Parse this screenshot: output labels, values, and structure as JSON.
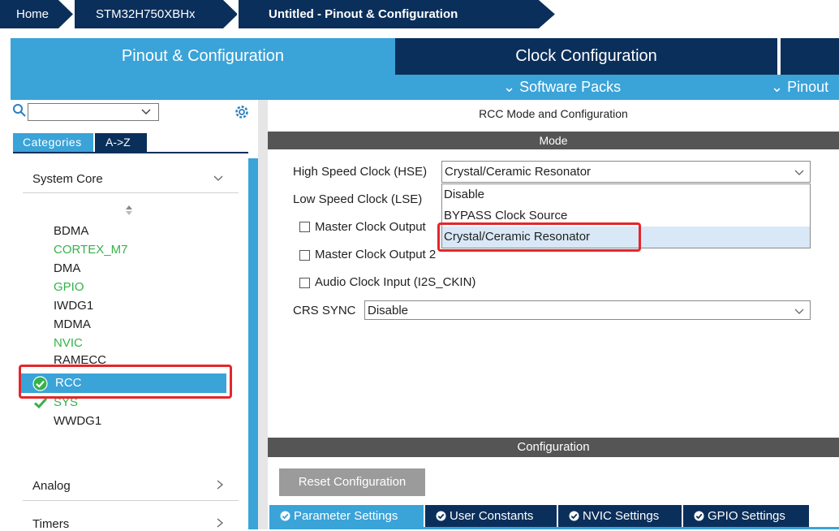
{
  "breadcrumb": {
    "home": "Home",
    "chip": "STM32H750XBHx",
    "project": "Untitled - Pinout & Configuration"
  },
  "tabs": {
    "pinout": "Pinout & Configuration",
    "clock": "Clock Configuration"
  },
  "menu": {
    "software_packs": "⌄ Software Packs",
    "pinout": "⌄ Pinout"
  },
  "left": {
    "search": {
      "value": "",
      "icon": "search-icon"
    },
    "view_tabs": {
      "categories": "Categories",
      "atoz": "A->Z"
    },
    "system_core": "System Core",
    "items": [
      {
        "label": "BDMA",
        "status": "none"
      },
      {
        "label": "CORTEX_M7",
        "status": "configured"
      },
      {
        "label": "DMA",
        "status": "none"
      },
      {
        "label": "GPIO",
        "status": "configured"
      },
      {
        "label": "IWDG1",
        "status": "none"
      },
      {
        "label": "MDMA",
        "status": "none"
      },
      {
        "label": "NVIC",
        "status": "configured"
      },
      {
        "label": "RAMECC",
        "status": "none"
      },
      {
        "label": "RCC",
        "status": "selected"
      },
      {
        "label": "SYS",
        "status": "ok"
      },
      {
        "label": "WWDG1",
        "status": "none"
      }
    ],
    "analog": "Analog",
    "timers": "Timers"
  },
  "rcc": {
    "title": "RCC Mode and Configuration",
    "mode_header": "Mode",
    "hse_label": "High Speed Clock (HSE)",
    "hse_value": "Crystal/Ceramic Resonator",
    "lse_label": "Low Speed Clock (LSE)",
    "hse_options": [
      "Disable",
      "BYPASS Clock Source",
      "Crystal/Ceramic Resonator"
    ],
    "mco1_label": "Master Clock Output",
    "mco2_label": "Master Clock Output 2",
    "audio_label": "Audio Clock Input (I2S_CKIN)",
    "crs_label": "CRS SYNC",
    "crs_value": "Disable",
    "config_header": "Configuration",
    "reset_button": "Reset Configuration",
    "subtabs": [
      "Parameter Settings",
      "User Constants",
      "NVIC Settings",
      "GPIO Settings"
    ]
  },
  "colors": {
    "navy": "#0b2f5b",
    "accent_blue": "#3aa3d8",
    "green": "#35b24a",
    "highlight_red": "#e4262b",
    "header_gray": "#555555"
  }
}
